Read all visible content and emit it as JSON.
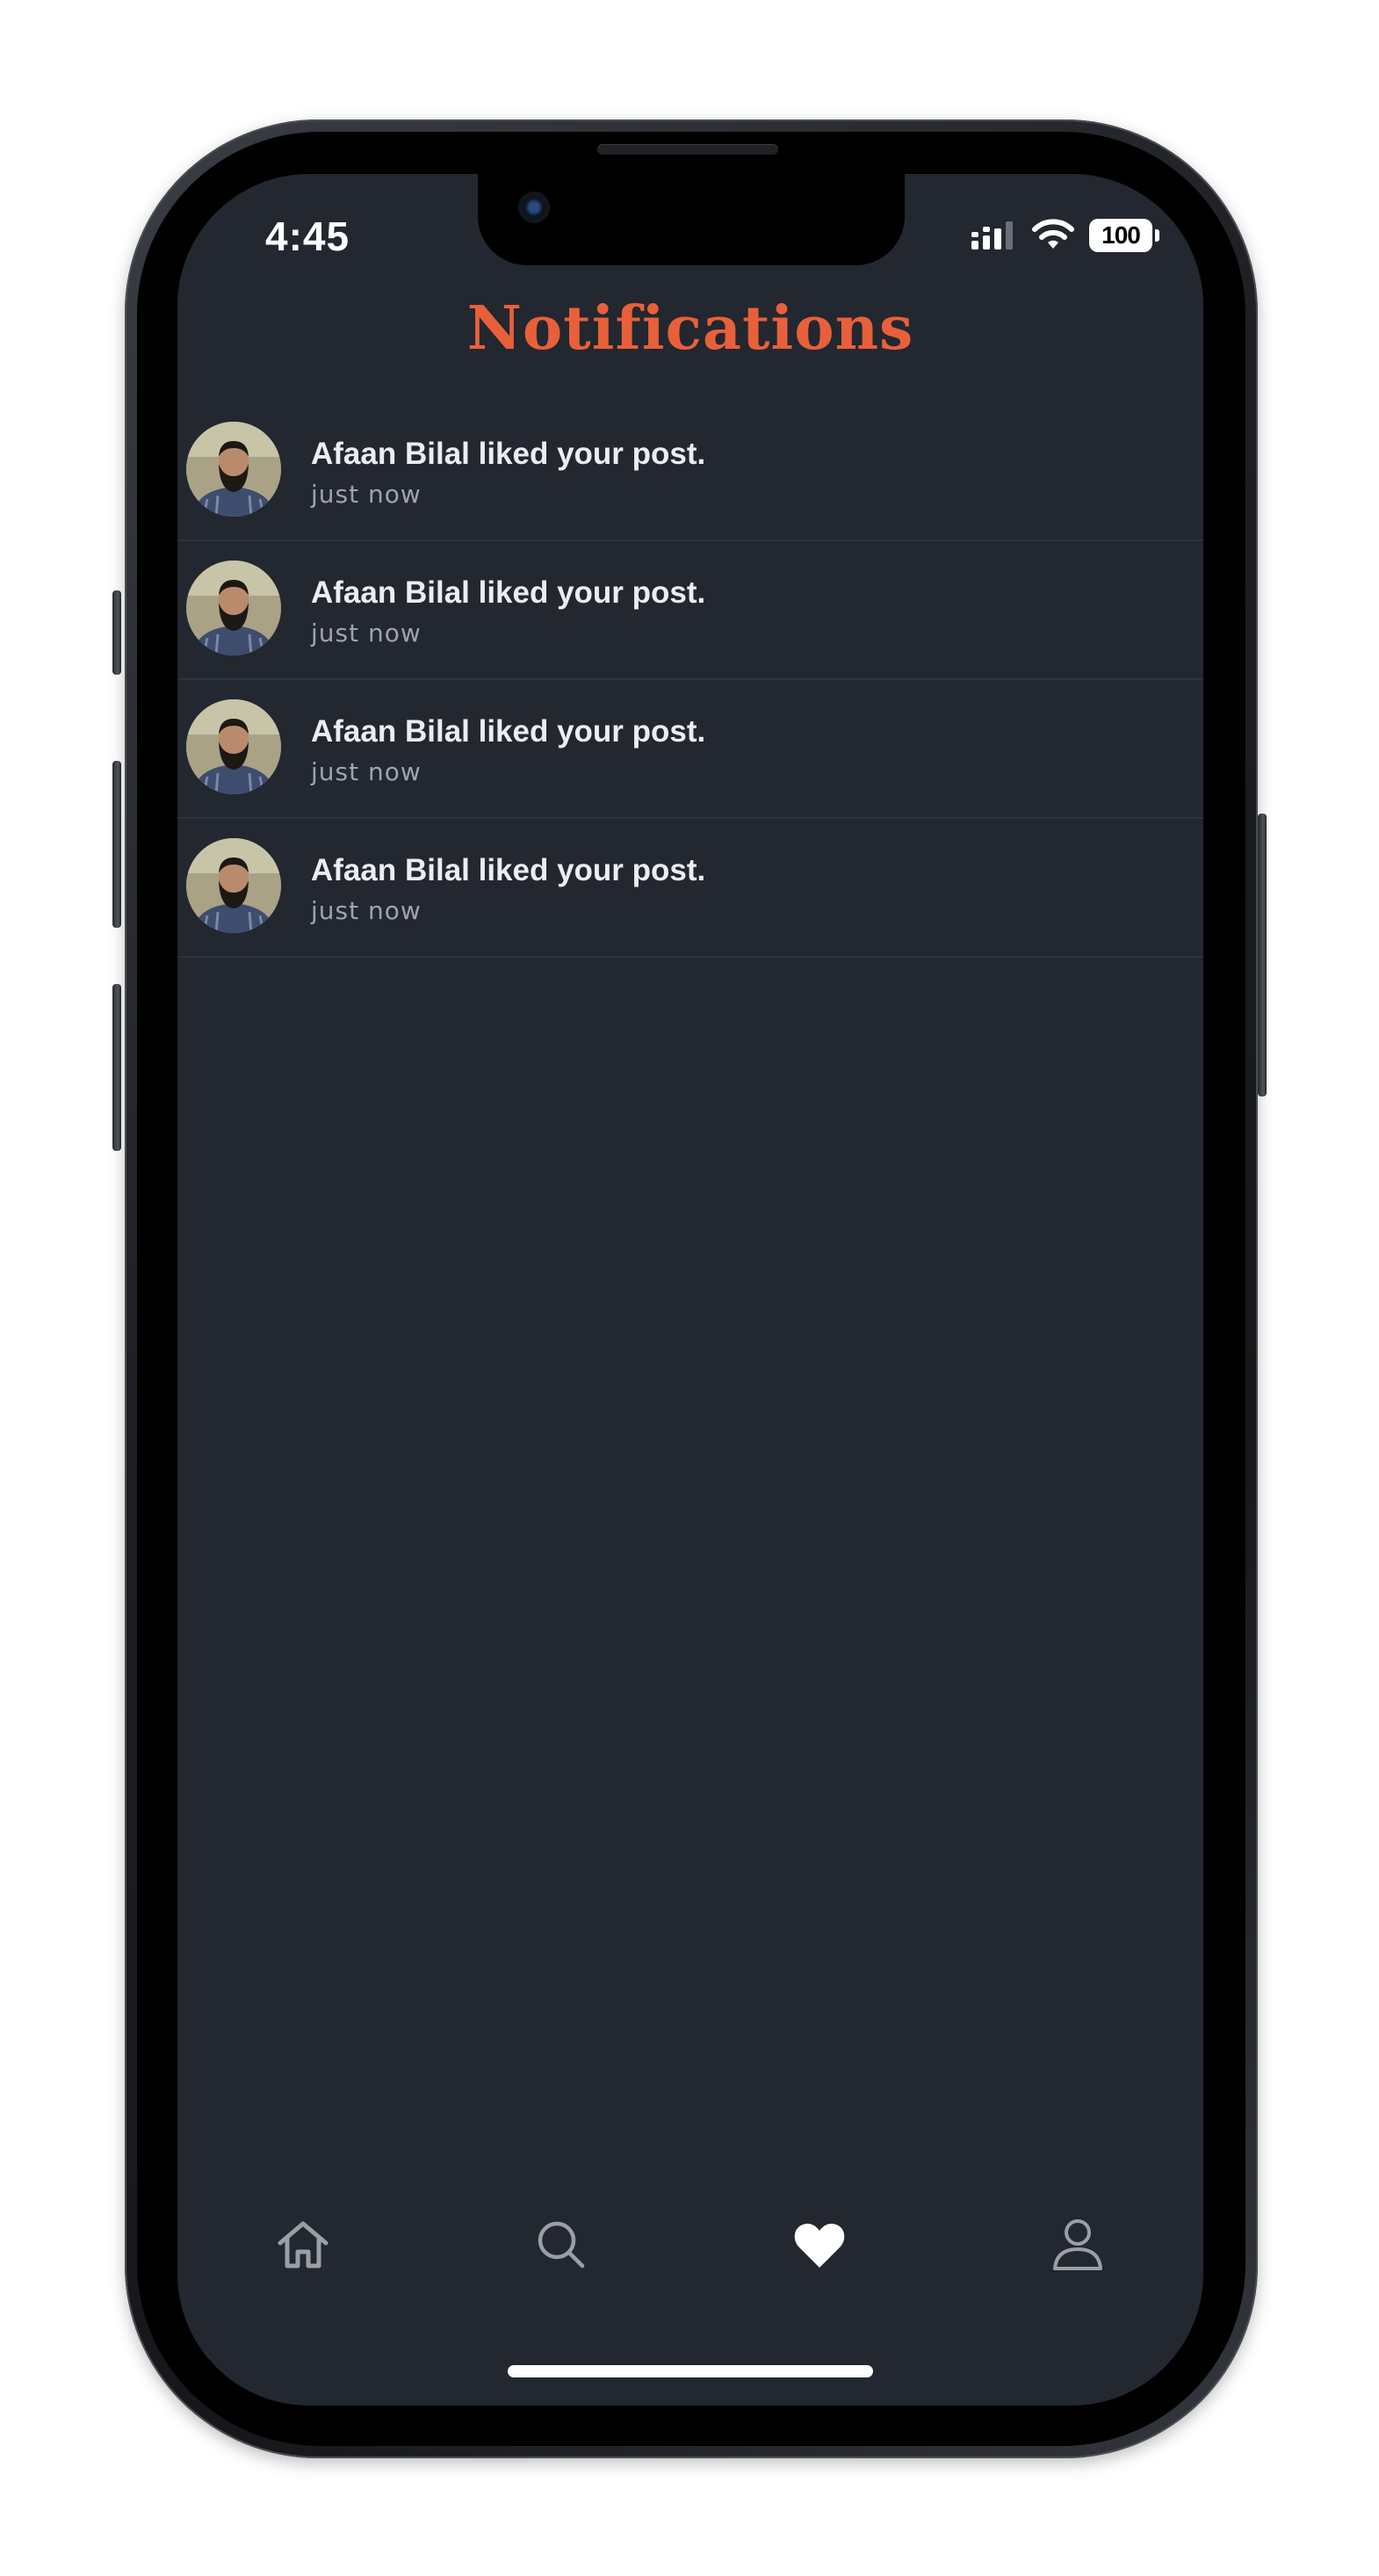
{
  "status_bar": {
    "time": "4:45",
    "battery": "100",
    "icons": [
      "signal-icon",
      "wifi-icon",
      "battery-icon"
    ]
  },
  "header": {
    "title": "Notifications",
    "title_color": "#e8603a"
  },
  "notifications": [
    {
      "message": "Afaan Bilal liked your post.",
      "time": "just now"
    },
    {
      "message": "Afaan Bilal liked your post.",
      "time": "just now"
    },
    {
      "message": "Afaan Bilal liked your post.",
      "time": "just now"
    },
    {
      "message": "Afaan Bilal liked your post.",
      "time": "just now"
    }
  ],
  "bottom_nav": {
    "items": [
      {
        "icon": "home-icon",
        "active": false
      },
      {
        "icon": "search-icon",
        "active": false
      },
      {
        "icon": "heart-icon",
        "active": true
      },
      {
        "icon": "profile-icon",
        "active": false
      }
    ]
  },
  "colors": {
    "background": "#232730",
    "text_primary": "#ebedf1",
    "text_secondary": "#9ea3ad",
    "accent": "#e8603a"
  }
}
